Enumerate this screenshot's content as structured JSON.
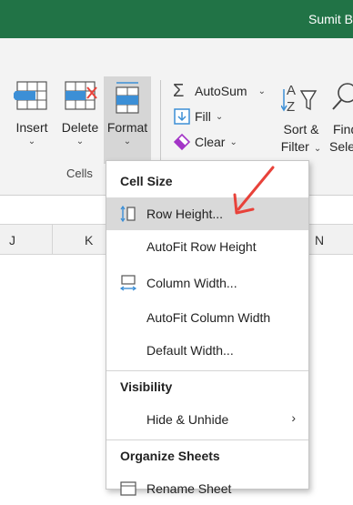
{
  "titlebar": {
    "user": "Sumit B"
  },
  "ribbon": {
    "cells_group": {
      "label": "Cells",
      "insert": "Insert",
      "delete": "Delete",
      "format": "Format"
    },
    "editing": {
      "autosum": "AutoSum",
      "fill": "Fill",
      "clear": "Clear",
      "sort_filter_line1": "Sort &",
      "sort_filter_line2": "Filter",
      "find_line1": "Find",
      "find_line2": "Sele"
    }
  },
  "columns": [
    "J",
    "K",
    "N"
  ],
  "format_menu": {
    "cell_size_header": "Cell Size",
    "row_height": "Row Height...",
    "autofit_row_height": "AutoFit Row Height",
    "column_width": "Column Width...",
    "autofit_column_width": "AutoFit Column Width",
    "default_width": "Default Width...",
    "visibility_header": "Visibility",
    "hide_unhide": "Hide & Unhide",
    "organize_header": "Organize Sheets",
    "rename_sheet": "Rename Sheet"
  },
  "colors": {
    "excel_green": "#217346",
    "annotation_red": "#e8423a",
    "highlight": "#d9d9d9"
  }
}
